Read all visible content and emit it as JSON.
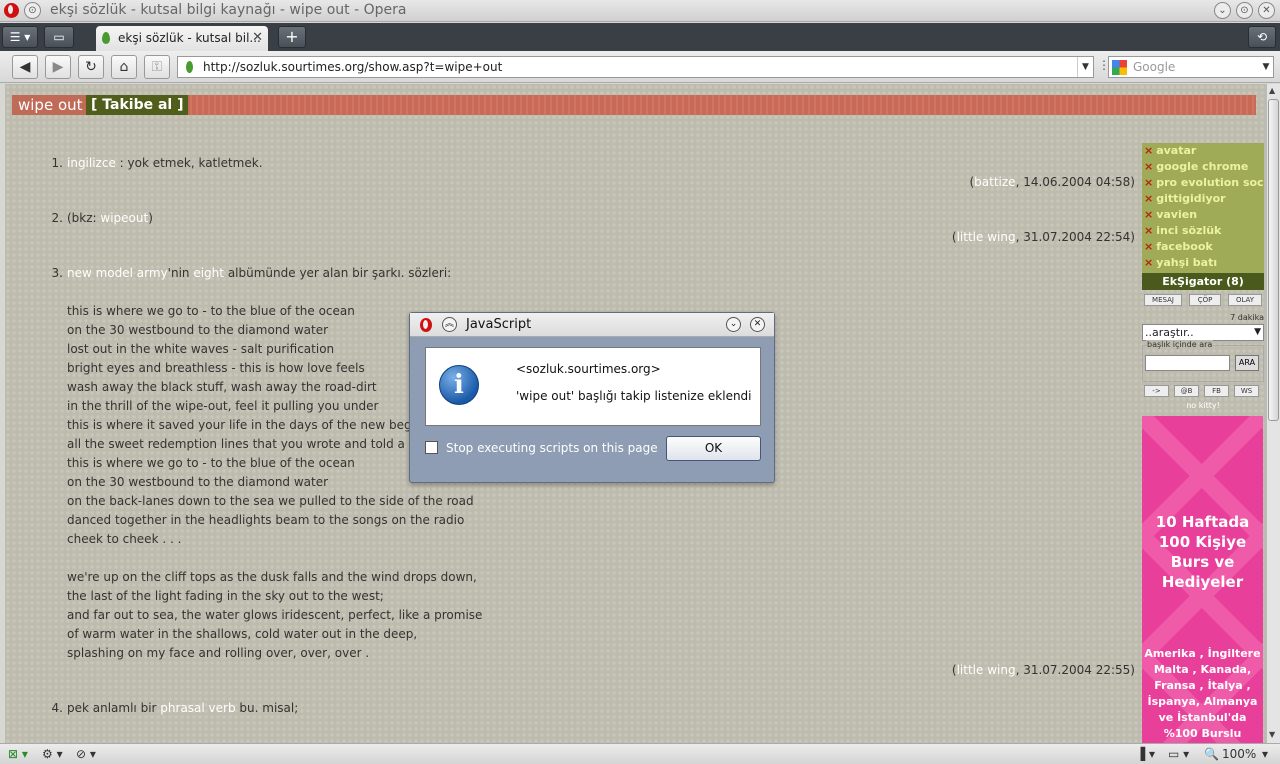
{
  "window": {
    "title": "ekşi sözlük - kutsal bilgi kaynağı - wipe out - Opera"
  },
  "tabs": [
    {
      "label": "ekşi sözlük - kutsal bil...",
      "close": "✕"
    }
  ],
  "address_bar": {
    "url": "http://sozluk.sourtimes.org/show.asp?t=wipe+out",
    "search_placeholder": "Google"
  },
  "page": {
    "topic_title": "wipe out",
    "follow_button": "[ Takibe al ]",
    "entries": [
      {
        "num": "1.",
        "lines": [
          [
            {
              "t": "ingilizce",
              "link": true
            },
            {
              "t": " : yok etmek, katletmek."
            }
          ]
        ],
        "author": "battize",
        "date": ", 14.06.2004 04:58)"
      },
      {
        "num": "2.",
        "lines": [
          [
            {
              "t": "(bkz: "
            },
            {
              "t": "wipeout",
              "link": true
            },
            {
              "t": ")"
            }
          ]
        ],
        "author": "little wing",
        "date": ", 31.07.2004 22:54)"
      },
      {
        "num": "3.",
        "lines": [
          [
            {
              "t": "new model army",
              "link": true
            },
            {
              "t": "'nin "
            },
            {
              "t": "eight",
              "link": true
            },
            {
              "t": " albümünde yer alan bir şarkı. sözleri:"
            }
          ],
          [
            {
              "t": ""
            }
          ],
          [
            {
              "t": "this is where we go to - to the blue of the ocean"
            }
          ],
          [
            {
              "t": "on the 30 westbound to the diamond water"
            }
          ],
          [
            {
              "t": "lost out in the white waves - salt purification"
            }
          ],
          [
            {
              "t": "bright eyes and breathless - this is how love feels"
            }
          ],
          [
            {
              "t": "wash away the black stuff, wash away the road-dirt"
            }
          ],
          [
            {
              "t": "in the thrill of the wipe-out, feel it pulling you under"
            }
          ],
          [
            {
              "t": "this is where it saved your life in the days of the new beginning"
            }
          ],
          [
            {
              "t": "all the sweet redemption lines that you wrote and told a thousand times"
            }
          ],
          [
            {
              "t": "this is where we go to - to the blue of the ocean"
            }
          ],
          [
            {
              "t": "on the 30 westbound to the diamond water"
            }
          ],
          [
            {
              "t": "on the back-lanes down to the sea we pulled to the side of the road"
            }
          ],
          [
            {
              "t": "danced together in the headlights beam to the songs on the radio"
            }
          ],
          [
            {
              "t": "cheek to cheek . . ."
            }
          ],
          [
            {
              "t": ""
            }
          ],
          [
            {
              "t": "we're up on the cliff tops as the dusk falls and the wind drops down,"
            }
          ],
          [
            {
              "t": "the last of the light fading in the sky out to the west;"
            }
          ],
          [
            {
              "t": "and far out to sea, the water glows iridescent, perfect, like a promise"
            }
          ],
          [
            {
              "t": "of warm water in the shallows, cold water out in the deep,"
            }
          ],
          [
            {
              "t": "splashing on my face and rolling over, over, over ."
            }
          ]
        ],
        "author": "little wing",
        "date": ", 31.07.2004 22:55)"
      },
      {
        "num": "4.",
        "lines": [
          [
            {
              "t": "pek anlamlı bir "
            },
            {
              "t": "phrasal verb",
              "link": true
            },
            {
              "t": " bu. misal;"
            }
          ]
        ]
      }
    ]
  },
  "sidebar": {
    "follow_items": [
      "avatar",
      "google chrome",
      "pro evolution socc...",
      "gittigidiyor",
      "vavien",
      "inci sözlük",
      "facebook",
      "yahşi batı"
    ],
    "eksigator": "EkŞigator (8)",
    "mini_buttons": [
      "MESAJ",
      "ÇÖP",
      "OLAY"
    ],
    "time_label": "7 dakika",
    "select_value": "..araştır..",
    "search_legend": "başlık içinde ara",
    "search_button": "ARA",
    "link_buttons": [
      "->",
      "@B",
      "FB",
      "WS"
    ],
    "no_kitty": "no kitty!",
    "ad": {
      "headline": "10 Haftada\n100 Kişiye\nBurs ve\nHediyeler",
      "countries": "Amerika , İngiltere\nMalta , Kanada,\nFransa , İtalya ,\nİspanya, Almanya\nve İstanbul'da\n%100 Burslu"
    }
  },
  "dialog": {
    "title": "JavaScript",
    "origin": "<sozluk.sourtimes.org>",
    "message": "'wipe out' başlığı takip listenize eklendi",
    "checkbox_label": "Stop executing scripts on this page",
    "ok_label": "OK"
  },
  "statusbar": {
    "zoom": "100%"
  }
}
